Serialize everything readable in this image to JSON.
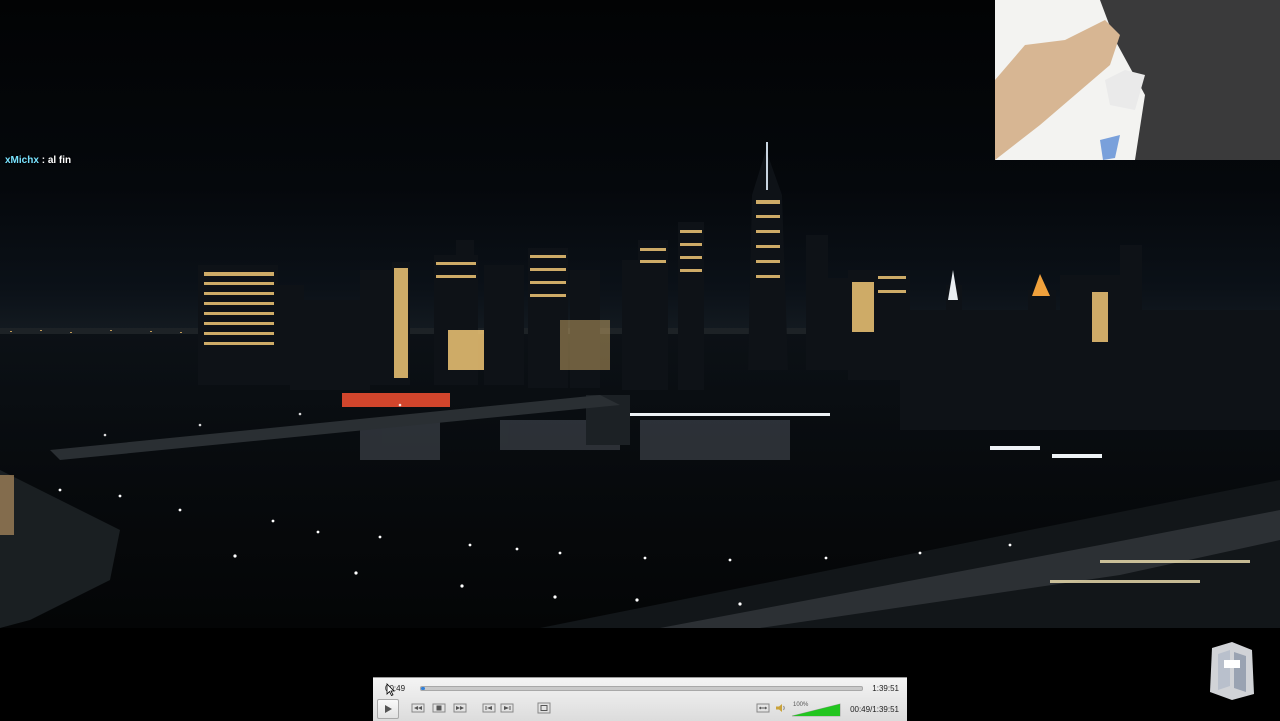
{
  "chat": {
    "username": "xMichx",
    "separator": ":",
    "message": "al fin"
  },
  "player": {
    "elapsed": "00:49",
    "duration": "1:39:51",
    "elapsed_total": "00:49/1:39:51",
    "volume_label": "100%",
    "progress_fraction": 0.008,
    "volume_fraction": 1.0,
    "accent_color": "#2f7fd8",
    "volume_color": "#22c51f"
  },
  "icons": {
    "play": "play-icon",
    "prev": "skip-back-icon",
    "stop": "stop-icon",
    "next": "skip-forward-icon",
    "prev_chapter": "previous-icon",
    "next_chapter": "next-icon",
    "fullscreen": "fullscreen-icon",
    "stretch": "aspect-ratio-icon",
    "speaker": "speaker-icon"
  }
}
